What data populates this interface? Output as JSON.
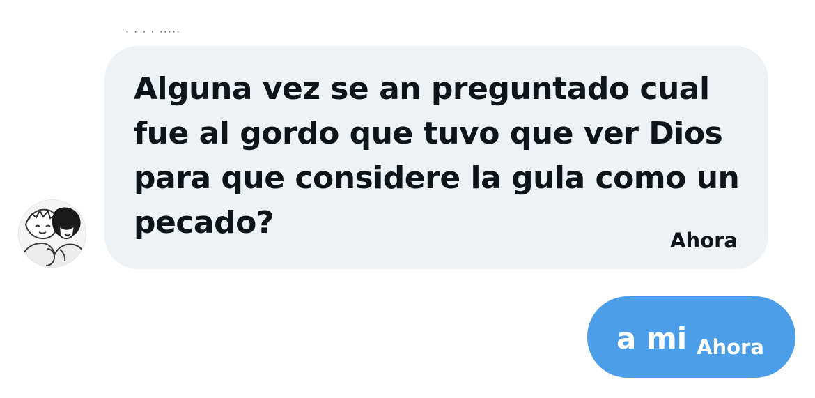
{
  "conversation": {
    "partial_header_text": "· · · ·   ·····",
    "contact": {
      "avatar_icon": "manga-avatar-icon"
    },
    "messages": [
      {
        "direction": "incoming",
        "text": "Alguna vez se an preguntado cual fue al gordo que tuvo que ver Dios para que considere la gula como un pecado?",
        "time": "Ahora",
        "bubble_color": "#eef2f4"
      },
      {
        "direction": "outgoing",
        "text": "a mi",
        "time": "Ahora",
        "bubble_color": "#4d9ee9"
      }
    ]
  }
}
